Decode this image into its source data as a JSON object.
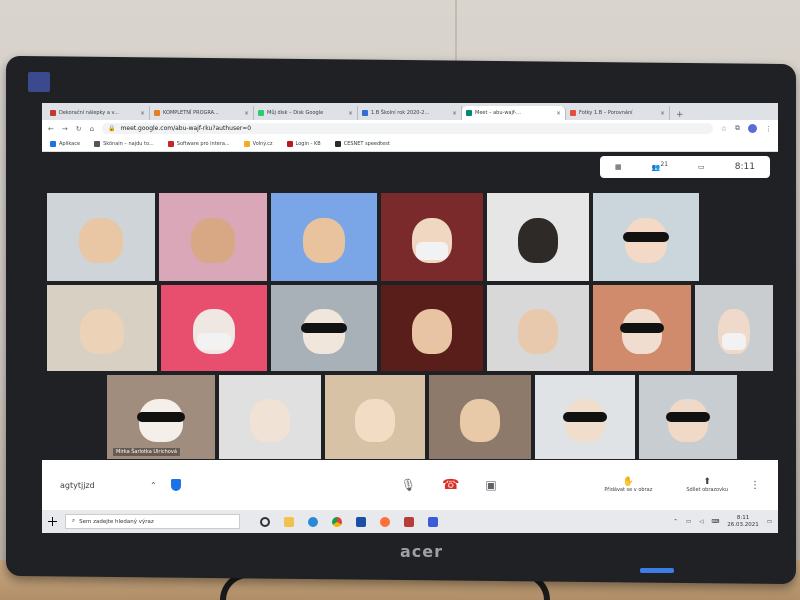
{
  "browser": {
    "tabs": [
      {
        "label": "Dekorační nálepky a v...",
        "color": "#c0392b"
      },
      {
        "label": "KOMPLETNÍ PROGRA...",
        "color": "#e67e22"
      },
      {
        "label": "Můj disk – Disk Google",
        "color": "#2ecc71"
      },
      {
        "label": "1.B Školní rok 2020-2...",
        "color": "#2f6fd6"
      },
      {
        "label": "Meet – abu-wajf-...",
        "color": "#00897b",
        "active": true
      },
      {
        "label": "Fotky 1.B – Porovnání",
        "color": "#e74c3c"
      }
    ],
    "new_tab": "+",
    "url": "meet.google.com/abu-wajf-rku?authuser=0",
    "bookmarks": [
      {
        "label": "Aplikace",
        "color": "#1a73e8"
      },
      {
        "label": "Skönain – najdu to...",
        "color": "#555555"
      },
      {
        "label": "Software pro intera...",
        "color": "#c62828"
      },
      {
        "label": "Volný.cz",
        "color": "#f9a825"
      },
      {
        "label": "Login - KB",
        "color": "#b71c1c"
      },
      {
        "label": "CESNET speedtest",
        "color": "#2b2b2b"
      }
    ]
  },
  "meet": {
    "time": "8:11",
    "participants_count": "21",
    "meeting_code": "agtytjjzd",
    "pinned_name": "Mirka Šarlotka Ulrichová",
    "present_label": "Přidávat se v obraz",
    "share_label": "Sdílet obrazovku"
  },
  "taskbar": {
    "search_placeholder": "Sem zadejte hledaný výraz",
    "time": "8:11",
    "date": "26.03.2021"
  },
  "monitor": {
    "brand": "acer"
  },
  "tiles": [
    {
      "bg": "#cfd4d9",
      "skin": "#e9c7a4",
      "extra": "none"
    },
    {
      "bg": "#d9a7b7",
      "skin": "#d8a884",
      "extra": "none"
    },
    {
      "bg": "#7aa6e8",
      "skin": "#e8c39d",
      "extra": "none"
    },
    {
      "bg": "#7a2a2a",
      "skin": "#efd7c2",
      "extra": "mask"
    },
    {
      "bg": "#e6e6e6",
      "skin": "#2d2a28",
      "extra": "none"
    },
    {
      "bg": "#cbd6dc",
      "skin": "#f3d9c6",
      "extra": "glasses"
    },
    {
      "bg": "#d9d0c4",
      "skin": "#ecd2b6",
      "extra": "none"
    },
    {
      "bg": "#e84f6f",
      "skin": "#efe7e2",
      "extra": "mask"
    },
    {
      "bg": "#a8b1b8",
      "skin": "#f1e6dc",
      "extra": "glasses"
    },
    {
      "bg": "#5a1e1a",
      "skin": "#e8c3a4",
      "extra": "none"
    },
    {
      "bg": "#d8d8d8",
      "skin": "#e9c9ad",
      "extra": "none"
    },
    {
      "bg": "#cf8b6b",
      "skin": "#f1ddd0",
      "extra": "glasses"
    },
    {
      "bg": "#c9cdd0",
      "skin": "#eed9ca",
      "extra": "mask"
    },
    {
      "bg": "#a08d7e",
      "skin": "#f5efe9",
      "extra": "glasses"
    },
    {
      "bg": "#e0e0e0",
      "skin": "#f0e2d4",
      "extra": "none"
    },
    {
      "bg": "#d7c2a6",
      "skin": "#f2dcc3",
      "extra": "none"
    },
    {
      "bg": "#8d7a6a",
      "skin": "#e8c9a8",
      "extra": "none"
    },
    {
      "bg": "#dfe3e6",
      "skin": "#f1ddcc",
      "extra": "glasses"
    },
    {
      "bg": "#c8cdd2",
      "skin": "#f0d9c6",
      "extra": "glasses"
    }
  ]
}
